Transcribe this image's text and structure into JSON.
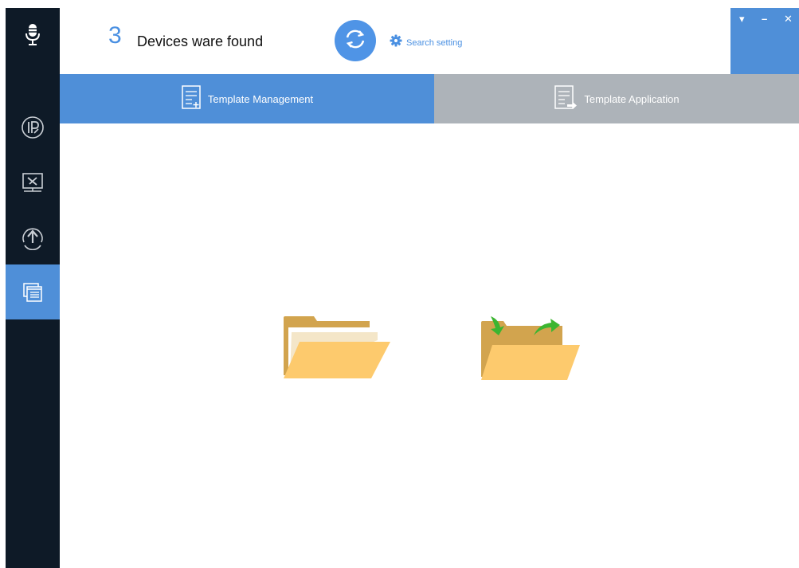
{
  "header": {
    "device_count": "3",
    "found_label": "Devices ware found",
    "search_setting_label": "Search setting"
  },
  "window_controls": {
    "menu": "▾",
    "minimize": "–",
    "close": "✕"
  },
  "tabs": [
    {
      "label": "Template Management",
      "active": true,
      "icon": "template-add-icon"
    },
    {
      "label": "Template Application",
      "active": false,
      "icon": "template-apply-icon"
    }
  ],
  "sidebar": {
    "logo_icon": "microphone-icon",
    "items": [
      {
        "icon": "ip-edit-icon",
        "active": false
      },
      {
        "icon": "tools-monitor-icon",
        "active": false
      },
      {
        "icon": "upgrade-icon",
        "active": false
      },
      {
        "icon": "template-window-icon",
        "active": true
      }
    ]
  },
  "content": {
    "folders": [
      {
        "icon": "open-folder-icon"
      },
      {
        "icon": "import-export-folder-icon"
      }
    ]
  },
  "colors": {
    "accent": "#4f8fd8",
    "sidebar_bg": "#0e1a27",
    "tab_inactive": "#adb3b9",
    "folder_front": "#fdca6d",
    "folder_back": "#d2a44e",
    "arrow_green": "#3cb531"
  }
}
